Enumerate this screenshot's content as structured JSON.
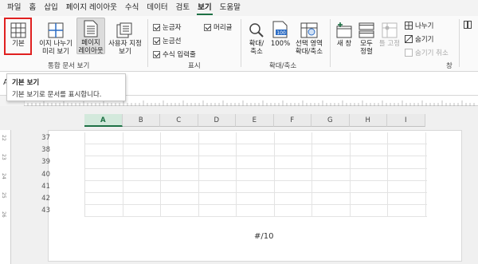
{
  "menu": {
    "tabs": [
      "파일",
      "홈",
      "삽입",
      "페이지 레이아웃",
      "수식",
      "데이터",
      "검토",
      "보기",
      "도움말"
    ],
    "active_index": 7
  },
  "ribbon": {
    "workbook_views": {
      "normal": "기본",
      "page_break_line1": "이지 나누기",
      "page_break_line2": "미리 보기",
      "page_layout_line1": "페이지",
      "page_layout_line2": "레이아웃",
      "custom_line1": "사용자 지정",
      "custom_line2": "보기",
      "group_label": "통합 문서 보기"
    },
    "show": {
      "ruler": "눈금자",
      "gridlines": "눈금선",
      "formula_bar": "수식 입력줄",
      "headings": "머리글",
      "group_label": "표시"
    },
    "zoom": {
      "zoom_line1": "확대/",
      "zoom_line2": "축소",
      "hundred": "100%",
      "hundred_icon_text": "100",
      "selection_line1": "선택 영역",
      "selection_line2": "확대/축소",
      "group_label": "확대/축소"
    },
    "window": {
      "new_window": "새 창",
      "arrange_line1": "모두",
      "arrange_line2": "정렬",
      "freeze": "틀 고정",
      "split": "나누기",
      "hide": "숨기기",
      "unhide": "숨기기 취소",
      "group_label": "창"
    }
  },
  "tooltip": {
    "title": "기본 보기",
    "description": "기본 보기로 문서를 표시합니다."
  },
  "formula_bar": {
    "name_box_edge": "A"
  },
  "sheet": {
    "columns": [
      "A",
      "B",
      "C",
      "D",
      "E",
      "F",
      "G",
      "H",
      "I"
    ],
    "selected_column": "A",
    "rows": [
      "37",
      "38",
      "39",
      "40",
      "41",
      "42",
      "43"
    ],
    "left_ruler_marks": [
      "22",
      "23",
      "24",
      "25",
      "26"
    ],
    "footer": "#/10"
  },
  "colors": {
    "accent": "#1e7145",
    "highlight_box": "#e02020"
  }
}
